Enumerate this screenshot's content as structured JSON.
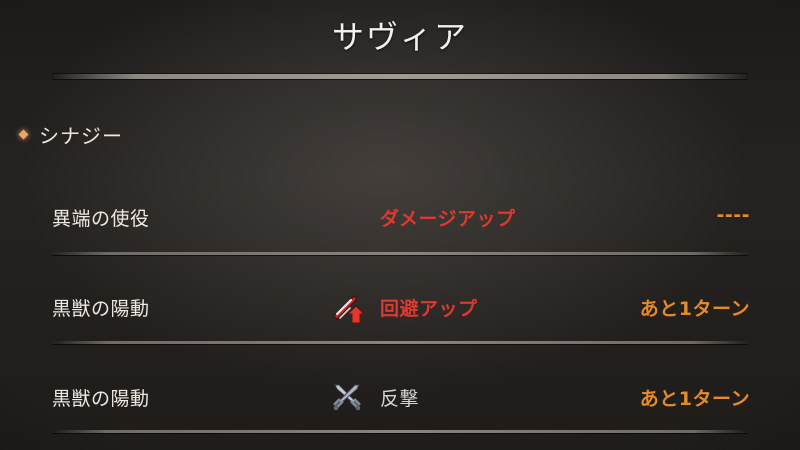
{
  "character": {
    "name": "サヴィア"
  },
  "section": {
    "label": "シナジー"
  },
  "rows": [
    {
      "name": "異端の使役",
      "effect": "ダメージアップ",
      "effect_color": "#e0382f",
      "duration": "----",
      "icon": null
    },
    {
      "name": "黒獣の陽動",
      "effect": "回避アップ",
      "effect_color": "#e0382f",
      "duration": "あと1ターン",
      "icon": "evasion-up-icon"
    },
    {
      "name": "黒獣の陽動",
      "effect": "反撃",
      "effect_color": "#d8d4cf",
      "duration": "あと1ターン",
      "icon": "counter-attack-icon"
    }
  ],
  "colors": {
    "accent_orange": "#e58a2a",
    "buff_red": "#e0382f",
    "diamond": "#e8a769"
  }
}
